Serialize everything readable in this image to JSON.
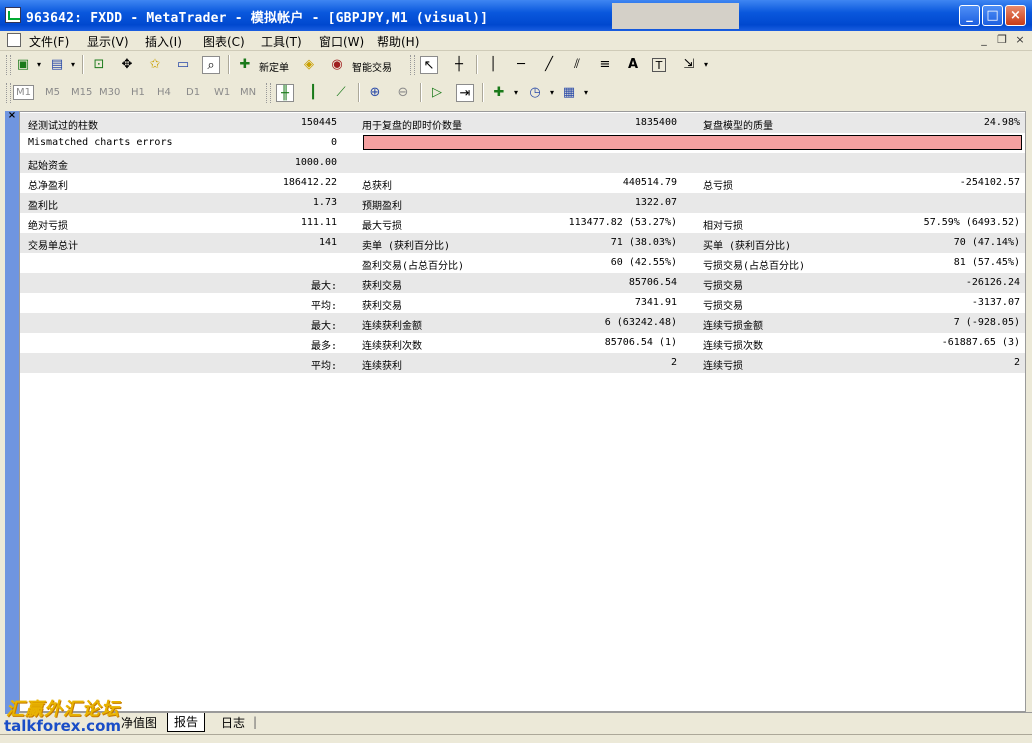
{
  "window": {
    "title": "963642: FXDD - MetaTrader - 模拟帐户 - [GBPJPY,M1 (visual)]",
    "controls": [
      "_",
      "□",
      "×"
    ]
  },
  "menu": {
    "items": [
      "文件(F)",
      "显示(V)",
      "插入(I)",
      "图表(C)",
      "工具(T)",
      "窗口(W)",
      "帮助(H)"
    ],
    "mdi": [
      "_",
      "❐",
      "×"
    ]
  },
  "toolbar": {
    "new_order": "新定单",
    "expert_advisors": "智能交易",
    "text_tool": "A",
    "text_label_tool": "T"
  },
  "timeframes": [
    "M1",
    "M5",
    "M15",
    "M30",
    "H1",
    "H4",
    "D1",
    "W1",
    "MN"
  ],
  "report": {
    "rows": [
      {
        "l1": "经测试过的柱数",
        "v1": "150445",
        "l2": "用于复盘的即时价数量",
        "v2": "1835400",
        "l3": "复盘模型的质量",
        "v3": "24.98%"
      },
      {
        "l1": "Mismatched charts errors",
        "v1": "0",
        "errorbar": true
      },
      {
        "l1": "起始资金",
        "v1": "1000.00"
      },
      {
        "l1": "总净盈利",
        "v1": "186412.22",
        "l2": "总获利",
        "v2": "440514.79",
        "l3": "总亏损",
        "v3": "-254102.57"
      },
      {
        "l1": "盈利比",
        "v1": "1.73",
        "l2": "预期盈利",
        "v2": "1322.07"
      },
      {
        "l1": "绝对亏损",
        "v1": "111.11",
        "l2": "最大亏损",
        "v2": "113477.82 (53.27%)",
        "l3": "相对亏损",
        "v3": "57.59% (6493.52)"
      },
      {
        "l1": "交易单总计",
        "v1": "141",
        "l2": "卖单 (获利百分比)",
        "v2": "71 (38.03%)",
        "l3": "买单 (获利百分比)",
        "v3": "70 (47.14%)"
      },
      {
        "l2": "盈利交易(占总百分比)",
        "v2": "60 (42.55%)",
        "l3": "亏损交易(占总百分比)",
        "v3": "81 (57.45%)"
      },
      {
        "v1": "最大:",
        "l2": "获利交易",
        "v2": "85706.54",
        "l3": "亏损交易",
        "v3": "-26126.24"
      },
      {
        "v1": "平均:",
        "l2": "获利交易",
        "v2": "7341.91",
        "l3": "亏损交易",
        "v3": "-3137.07"
      },
      {
        "v1": "最大:",
        "l2": "连续获利金额",
        "v2": "6 (63242.48)",
        "l3": "连续亏损金额",
        "v3": "7 (-928.05)"
      },
      {
        "v1": "最多:",
        "l2": "连续获利次数",
        "v2": "85706.54 (1)",
        "l3": "连续亏损次数",
        "v3": "-61887.65 (3)"
      },
      {
        "v1": "平均:",
        "l2": "连续获利",
        "v2": "2",
        "l3": "连续亏损",
        "v3": "2"
      }
    ]
  },
  "tabs": [
    {
      "label": "净值图",
      "active": false
    },
    {
      "label": "报告",
      "active": true
    },
    {
      "label": "日志",
      "active": false
    }
  ],
  "watermark": {
    "cn": "汇赢外汇论坛",
    "en": "talkforex.com"
  },
  "colors": {
    "titlebar": "#0a58dd",
    "error_bar": "#f4a0a0",
    "alt_row": "#e8e8e8"
  }
}
